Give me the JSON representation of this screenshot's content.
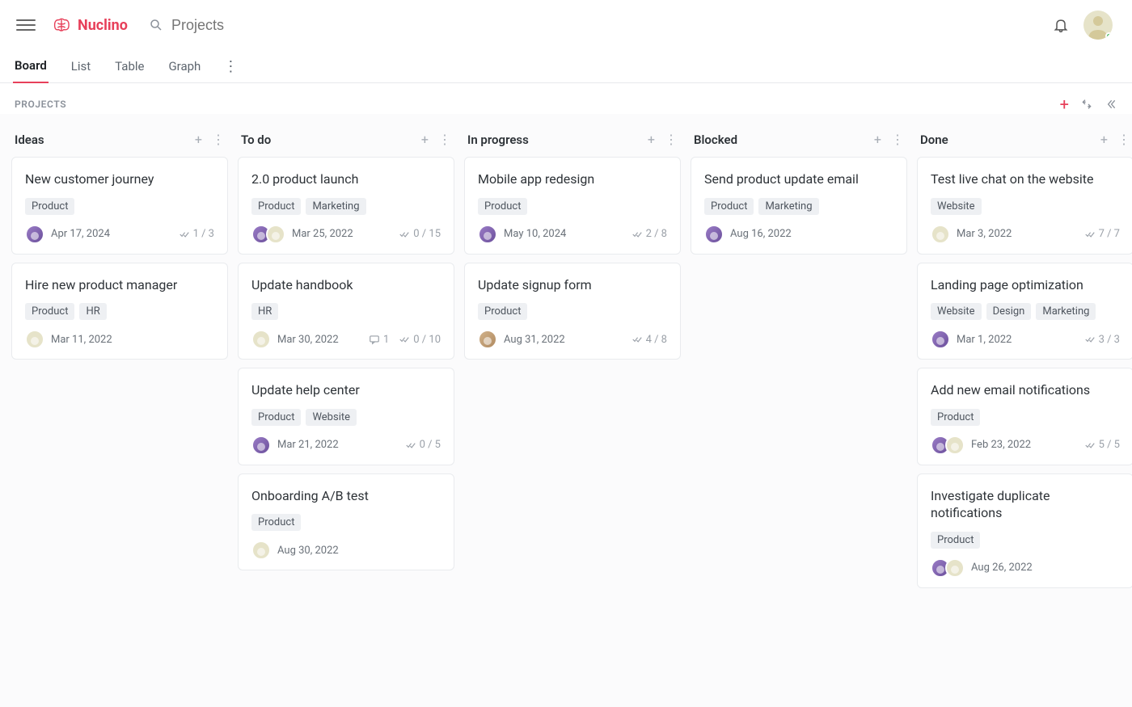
{
  "app": {
    "name": "Nuclino"
  },
  "search": {
    "placeholder": "Projects"
  },
  "tabs": {
    "board": "Board",
    "list": "List",
    "table": "Table",
    "graph": "Graph"
  },
  "board": {
    "label": "PROJECTS",
    "columns": [
      {
        "title": "Ideas",
        "cards": [
          {
            "title": "New customer journey",
            "tags": [
              "Product"
            ],
            "avatars": [
              "a"
            ],
            "date": "Apr 17, 2024",
            "progress": "1 / 3"
          },
          {
            "title": "Hire new product manager",
            "tags": [
              "Product",
              "HR"
            ],
            "avatars": [
              "b"
            ],
            "date": "Mar 11, 2022"
          }
        ]
      },
      {
        "title": "To do",
        "cards": [
          {
            "title": "2.0 product launch",
            "tags": [
              "Product",
              "Marketing"
            ],
            "avatars": [
              "a",
              "b"
            ],
            "date": "Mar 25, 2022",
            "progress": "0 / 15"
          },
          {
            "title": "Update handbook",
            "tags": [
              "HR"
            ],
            "avatars": [
              "b"
            ],
            "date": "Mar 30, 2022",
            "comments": "1",
            "progress": "0 / 10"
          },
          {
            "title": "Update help center",
            "tags": [
              "Product",
              "Website"
            ],
            "avatars": [
              "a"
            ],
            "date": "Mar 21, 2022",
            "progress": "0 / 5"
          },
          {
            "title": "Onboarding A/B test",
            "tags": [
              "Product"
            ],
            "avatars": [
              "b"
            ],
            "date": "Aug 30, 2022"
          }
        ]
      },
      {
        "title": "In progress",
        "cards": [
          {
            "title": "Mobile app redesign",
            "tags": [
              "Product"
            ],
            "avatars": [
              "a"
            ],
            "date": "May 10, 2024",
            "progress": "2 / 8"
          },
          {
            "title": "Update signup form",
            "tags": [
              "Product"
            ],
            "avatars": [
              "c"
            ],
            "date": "Aug 31, 2022",
            "progress": "4 / 8"
          }
        ]
      },
      {
        "title": "Blocked",
        "cards": [
          {
            "title": "Send product update email",
            "tags": [
              "Product",
              "Marketing"
            ],
            "avatars": [
              "a"
            ],
            "date": "Aug 16, 2022"
          }
        ]
      },
      {
        "title": "Done",
        "cards": [
          {
            "title": "Test live chat on the website",
            "tags": [
              "Website"
            ],
            "avatars": [
              "b"
            ],
            "date": "Mar 3, 2022",
            "progress": "7 / 7"
          },
          {
            "title": "Landing page optimization",
            "tags": [
              "Website",
              "Design",
              "Marketing"
            ],
            "avatars": [
              "a"
            ],
            "date": "Mar 1, 2022",
            "progress": "3 / 3"
          },
          {
            "title": "Add new email notifications",
            "tags": [
              "Product"
            ],
            "avatars": [
              "a",
              "b"
            ],
            "date": "Feb 23, 2022",
            "progress": "5 / 5"
          },
          {
            "title": "Investigate duplicate notifications",
            "tags": [
              "Product"
            ],
            "avatars": [
              "a",
              "b"
            ],
            "date": "Aug 26, 2022"
          }
        ]
      }
    ]
  }
}
